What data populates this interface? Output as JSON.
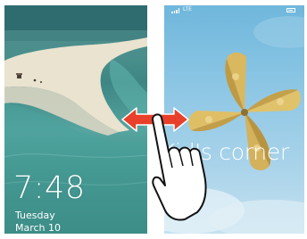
{
  "lock_screen": {
    "time": "7:48",
    "day": "Tuesday",
    "date": "March 10"
  },
  "kids_corner": {
    "network": "LTE",
    "title": "Kid's corner"
  },
  "icons": {
    "signal": "signal-strength-icon",
    "battery": "battery-icon",
    "swipe": "double-arrow-icon",
    "gesture": "hand-swipe-icon"
  },
  "colors": {
    "arrow": "#e8402a",
    "lock_text": "#ffffff",
    "kids_sky": "#7cbde0",
    "pinwheel": "#d8b45a"
  }
}
